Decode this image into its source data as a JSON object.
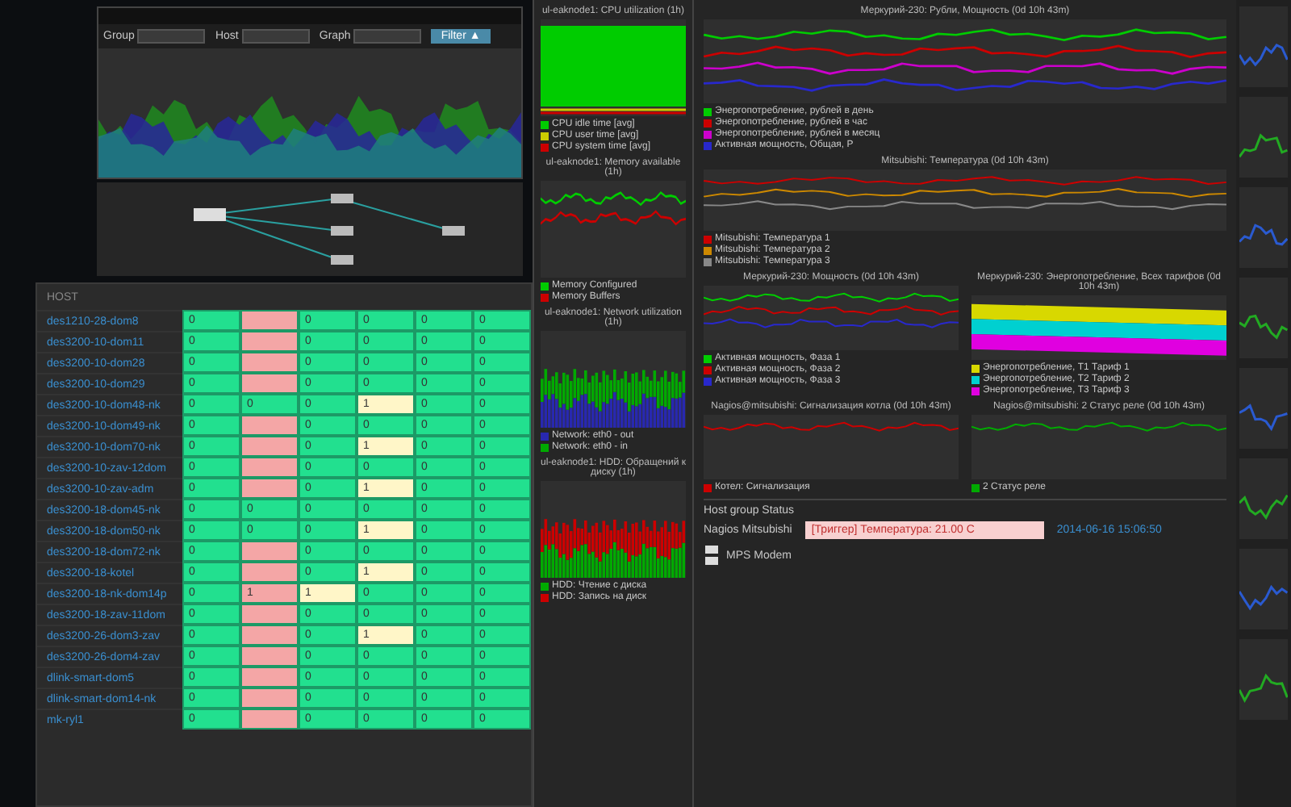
{
  "traffic_window": {
    "fields": [
      {
        "label": "Group"
      },
      {
        "label": "Host"
      },
      {
        "label": "Graph"
      }
    ],
    "filter_button": "Filter ▲",
    "chart": {
      "kind": "area"
    }
  },
  "host_table": {
    "header": "HOST",
    "rows": [
      {
        "host": "des1210-28-dom8",
        "cells": [
          {
            "color": "#22e08f",
            "value": "0"
          },
          {
            "color": "#f4a6a6"
          },
          {
            "color": "#22e08f",
            "value": "0"
          },
          {
            "color": "#22e08f",
            "value": "0"
          },
          {
            "color": "#22e08f",
            "value": "0"
          },
          {
            "color": "#22e08f",
            "value": "0"
          }
        ]
      },
      {
        "host": "des3200-10-dom11",
        "cells": [
          {
            "color": "#22e08f",
            "value": "0"
          },
          {
            "color": "#f4a6a6"
          },
          {
            "color": "#22e08f",
            "value": "0"
          },
          {
            "color": "#22e08f",
            "value": "0"
          },
          {
            "color": "#22e08f",
            "value": "0"
          },
          {
            "color": "#22e08f",
            "value": "0"
          }
        ]
      },
      {
        "host": "des3200-10-dom28",
        "cells": [
          {
            "color": "#22e08f",
            "value": "0"
          },
          {
            "color": "#f4a6a6"
          },
          {
            "color": "#22e08f",
            "value": "0"
          },
          {
            "color": "#22e08f",
            "value": "0"
          },
          {
            "color": "#22e08f",
            "value": "0"
          },
          {
            "color": "#22e08f",
            "value": "0"
          }
        ]
      },
      {
        "host": "des3200-10-dom29",
        "cells": [
          {
            "color": "#22e08f",
            "value": "0"
          },
          {
            "color": "#f4a6a6"
          },
          {
            "color": "#22e08f",
            "value": "0"
          },
          {
            "color": "#22e08f",
            "value": "0"
          },
          {
            "color": "#22e08f",
            "value": "0"
          },
          {
            "color": "#22e08f",
            "value": "0"
          }
        ]
      },
      {
        "host": "des3200-10-dom48-nk",
        "cells": [
          {
            "color": "#22e08f",
            "value": "0"
          },
          {
            "color": "#22e08f",
            "value": "0"
          },
          {
            "color": "#22e08f",
            "value": "0"
          },
          {
            "color": "#fff6c8",
            "value": "1"
          },
          {
            "color": "#22e08f",
            "value": "0"
          },
          {
            "color": "#22e08f",
            "value": "0"
          }
        ]
      },
      {
        "host": "des3200-10-dom49-nk",
        "cells": [
          {
            "color": "#22e08f",
            "value": "0"
          },
          {
            "color": "#f4a6a6"
          },
          {
            "color": "#22e08f",
            "value": "0"
          },
          {
            "color": "#22e08f",
            "value": "0"
          },
          {
            "color": "#22e08f",
            "value": "0"
          },
          {
            "color": "#22e08f",
            "value": "0"
          }
        ]
      },
      {
        "host": "des3200-10-dom70-nk",
        "cells": [
          {
            "color": "#22e08f",
            "value": "0"
          },
          {
            "color": "#f4a6a6"
          },
          {
            "color": "#22e08f",
            "value": "0"
          },
          {
            "color": "#fff6c8",
            "value": "1"
          },
          {
            "color": "#22e08f",
            "value": "0"
          },
          {
            "color": "#22e08f",
            "value": "0"
          }
        ]
      },
      {
        "host": "des3200-10-zav-12dom",
        "cells": [
          {
            "color": "#22e08f",
            "value": "0"
          },
          {
            "color": "#f4a6a6"
          },
          {
            "color": "#22e08f",
            "value": "0"
          },
          {
            "color": "#22e08f",
            "value": "0"
          },
          {
            "color": "#22e08f",
            "value": "0"
          },
          {
            "color": "#22e08f",
            "value": "0"
          }
        ]
      },
      {
        "host": "des3200-10-zav-adm",
        "cells": [
          {
            "color": "#22e08f",
            "value": "0"
          },
          {
            "color": "#f4a6a6"
          },
          {
            "color": "#22e08f",
            "value": "0"
          },
          {
            "color": "#fff6c8",
            "value": "1"
          },
          {
            "color": "#22e08f",
            "value": "0"
          },
          {
            "color": "#22e08f",
            "value": "0"
          }
        ]
      },
      {
        "host": "des3200-18-dom45-nk",
        "cells": [
          {
            "color": "#22e08f",
            "value": "0"
          },
          {
            "color": "#22e08f",
            "value": "0"
          },
          {
            "color": "#22e08f",
            "value": "0"
          },
          {
            "color": "#22e08f",
            "value": "0"
          },
          {
            "color": "#22e08f",
            "value": "0"
          },
          {
            "color": "#22e08f",
            "value": "0"
          }
        ]
      },
      {
        "host": "des3200-18-dom50-nk",
        "cells": [
          {
            "color": "#22e08f",
            "value": "0"
          },
          {
            "color": "#22e08f",
            "value": "0"
          },
          {
            "color": "#22e08f",
            "value": "0"
          },
          {
            "color": "#fff6c8",
            "value": "1"
          },
          {
            "color": "#22e08f",
            "value": "0"
          },
          {
            "color": "#22e08f",
            "value": "0"
          }
        ]
      },
      {
        "host": "des3200-18-dom72-nk",
        "cells": [
          {
            "color": "#22e08f",
            "value": "0"
          },
          {
            "color": "#f4a6a6"
          },
          {
            "color": "#22e08f",
            "value": "0"
          },
          {
            "color": "#22e08f",
            "value": "0"
          },
          {
            "color": "#22e08f",
            "value": "0"
          },
          {
            "color": "#22e08f",
            "value": "0"
          }
        ]
      },
      {
        "host": "des3200-18-kotel",
        "cells": [
          {
            "color": "#22e08f",
            "value": "0"
          },
          {
            "color": "#f4a6a6"
          },
          {
            "color": "#22e08f",
            "value": "0"
          },
          {
            "color": "#fff6c8",
            "value": "1"
          },
          {
            "color": "#22e08f",
            "value": "0"
          },
          {
            "color": "#22e08f",
            "value": "0"
          }
        ]
      },
      {
        "host": "des3200-18-nk-dom14p",
        "cells": [
          {
            "color": "#22e08f",
            "value": "0"
          },
          {
            "color": "#f4a6a6",
            "value": "1"
          },
          {
            "color": "#fff6c8",
            "value": "1"
          },
          {
            "color": "#22e08f",
            "value": "0"
          },
          {
            "color": "#22e08f",
            "value": "0"
          },
          {
            "color": "#22e08f",
            "value": "0"
          }
        ]
      },
      {
        "host": "des3200-18-zav-11dom",
        "cells": [
          {
            "color": "#22e08f",
            "value": "0"
          },
          {
            "color": "#f4a6a6"
          },
          {
            "color": "#22e08f",
            "value": "0"
          },
          {
            "color": "#22e08f",
            "value": "0"
          },
          {
            "color": "#22e08f",
            "value": "0"
          },
          {
            "color": "#22e08f",
            "value": "0"
          }
        ]
      },
      {
        "host": "des3200-26-dom3-zav",
        "cells": [
          {
            "color": "#22e08f",
            "value": "0"
          },
          {
            "color": "#f4a6a6"
          },
          {
            "color": "#22e08f",
            "value": "0"
          },
          {
            "color": "#fff6c8",
            "value": "1"
          },
          {
            "color": "#22e08f",
            "value": "0"
          },
          {
            "color": "#22e08f",
            "value": "0"
          }
        ]
      },
      {
        "host": "des3200-26-dom4-zav",
        "cells": [
          {
            "color": "#22e08f",
            "value": "0"
          },
          {
            "color": "#f4a6a6"
          },
          {
            "color": "#22e08f",
            "value": "0"
          },
          {
            "color": "#22e08f",
            "value": "0"
          },
          {
            "color": "#22e08f",
            "value": "0"
          },
          {
            "color": "#22e08f",
            "value": "0"
          }
        ]
      },
      {
        "host": "dlink-smart-dom5",
        "cells": [
          {
            "color": "#22e08f",
            "value": "0"
          },
          {
            "color": "#f4a6a6"
          },
          {
            "color": "#22e08f",
            "value": "0"
          },
          {
            "color": "#22e08f",
            "value": "0"
          },
          {
            "color": "#22e08f",
            "value": "0"
          },
          {
            "color": "#22e08f",
            "value": "0"
          }
        ]
      },
      {
        "host": "dlink-smart-dom14-nk",
        "cells": [
          {
            "color": "#22e08f",
            "value": "0"
          },
          {
            "color": "#f4a6a6"
          },
          {
            "color": "#22e08f",
            "value": "0"
          },
          {
            "color": "#22e08f",
            "value": "0"
          },
          {
            "color": "#22e08f",
            "value": "0"
          },
          {
            "color": "#22e08f",
            "value": "0"
          }
        ]
      },
      {
        "host": "mk-ryl1",
        "cells": [
          {
            "color": "#22e08f",
            "value": "0"
          },
          {
            "color": "#f4a6a6"
          },
          {
            "color": "#22e08f",
            "value": "0"
          },
          {
            "color": "#22e08f",
            "value": "0"
          },
          {
            "color": "#22e08f",
            "value": "0"
          },
          {
            "color": "#22e08f",
            "value": "0"
          }
        ]
      }
    ]
  },
  "node_charts": [
    {
      "title": "ul-eaknode1: CPU utilization (1h)",
      "kind": "block",
      "legend": [
        {
          "label": "CPU idle time [avg]",
          "color": "#00cc00"
        },
        {
          "label": "CPU user time [avg]",
          "color": "#cccc00"
        },
        {
          "label": "CPU system time [avg]",
          "color": "#cc0000"
        }
      ]
    },
    {
      "title": "ul-eaknode1: Memory available (1h)",
      "kind": "line",
      "legend": [
        {
          "label": "Memory Configured",
          "color": "#00cc00"
        },
        {
          "label": "Memory Buffers",
          "color": "#cc0000"
        }
      ]
    },
    {
      "title": "ul-eaknode1: Network utilization (1h)",
      "kind": "bars",
      "legend": [
        {
          "label": "Network: eth0 - out",
          "color": "#2828b0"
        },
        {
          "label": "Network: eth0 - in",
          "color": "#00aa00"
        }
      ]
    },
    {
      "title": "ul-eaknode1: HDD: Обращений к диску (1h)",
      "kind": "bars",
      "legend": [
        {
          "label": "HDD: Чтение с диска",
          "color": "#00aa00"
        },
        {
          "label": "HDD: Запись на диск",
          "color": "#cc0000"
        }
      ]
    }
  ],
  "power_charts": [
    {
      "title": "Меркурий-230: Рубли, Мощность (0d 10h 43m)",
      "kind": "line",
      "legend": [
        {
          "label": "Энергопотребление, рублей в день",
          "color": "#00cc00"
        },
        {
          "label": "Энергопотребление, рублей в час",
          "color": "#cc0000"
        },
        {
          "label": "Энергопотребление, рублей в месяц",
          "color": "#cc00cc"
        },
        {
          "label": "Активная мощность, Общая, P",
          "color": "#2828cc"
        }
      ]
    },
    {
      "title": "Mitsubishi: Температура (0d 10h 43m)",
      "kind": "line",
      "legend": [
        {
          "label": "Mitsubishi: Температура 1",
          "color": "#cc0000"
        },
        {
          "label": "Mitsubishi: Температура 2",
          "color": "#cc8800"
        },
        {
          "label": "Mitsubishi: Температура 3",
          "color": "#888888"
        }
      ]
    }
  ],
  "small_charts": [
    {
      "title": "Меркурий-230: Мощность (0d 10h 43m)",
      "kind": "line",
      "legend": [
        {
          "label": "Активная мощность, Фаза 1",
          "color": "#00cc00"
        },
        {
          "label": "Активная мощность, Фаза 2",
          "color": "#cc0000"
        },
        {
          "label": "Активная мощность, Фаза 3",
          "color": "#2828cc"
        }
      ]
    },
    {
      "title": "Меркурий-230: Энергопотребление, Всех тарифов (0d 10h 43m)",
      "kind": "bands",
      "legend": [
        {
          "label": "Энергопотребление, Т1 Тариф 1",
          "color": "#d8d800"
        },
        {
          "label": "Энергопотребление, Т2 Тариф 2",
          "color": "#00d0d0"
        },
        {
          "label": "Энергопотребление, Т3 Тариф 3",
          "color": "#e000e0"
        }
      ]
    },
    {
      "title": "Nagios@mitsubishi: Сигнализация котла (0d 10h 43m)",
      "kind": "line",
      "legend": [
        {
          "label": "Котел: Сигнализация",
          "color": "#cc0000"
        }
      ]
    },
    {
      "title": "Nagios@mitsubishi: 2 Статус реле (0d 10h 43m)",
      "kind": "line",
      "legend": [
        {
          "label": "2 Статус реле",
          "color": "#00aa00"
        }
      ]
    }
  ],
  "group_status": {
    "title": "Host group Status",
    "group": "Nagios Mitsubishi",
    "issue": "[Триггер] Температура: 21.00 С",
    "time": "2014-06-16 15:06:50",
    "node": "MPS Modem"
  }
}
